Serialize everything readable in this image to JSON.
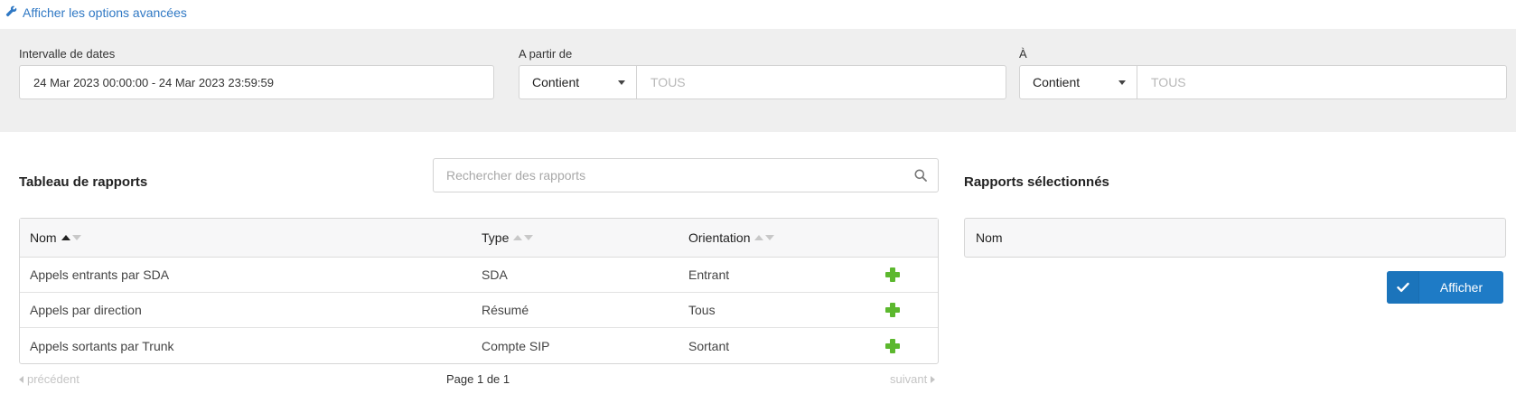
{
  "advanced_link": "Afficher les options avancées",
  "filters": {
    "date_range": {
      "label": "Intervalle de dates",
      "value": "24 Mar 2023 00:00:00 - 24 Mar 2023 23:59:59"
    },
    "from": {
      "label": "A partir de",
      "operator": "Contient",
      "placeholder": "TOUS"
    },
    "to": {
      "label": "À",
      "operator": "Contient",
      "placeholder": "TOUS"
    }
  },
  "reports_table": {
    "title": "Tableau de rapports",
    "search_placeholder": "Rechercher des rapports",
    "columns": [
      "Nom",
      "Type",
      "Orientation"
    ],
    "rows": [
      {
        "name": "Appels entrants par SDA",
        "type": "SDA",
        "orientation": "Entrant"
      },
      {
        "name": "Appels par direction",
        "type": "Résumé",
        "orientation": "Tous"
      },
      {
        "name": "Appels sortants par Trunk",
        "type": "Compte SIP",
        "orientation": "Sortant"
      }
    ],
    "pagination": {
      "prev": "précédent",
      "page": "Page 1 de 1",
      "next": "suivant"
    }
  },
  "selected_reports": {
    "title": "Rapports sélectionnés",
    "column": "Nom",
    "button_label": "Afficher"
  },
  "colors": {
    "accent": "#1e7bc6",
    "link": "#2f78c4",
    "add": "#5cb82e",
    "band": "#efefef"
  }
}
